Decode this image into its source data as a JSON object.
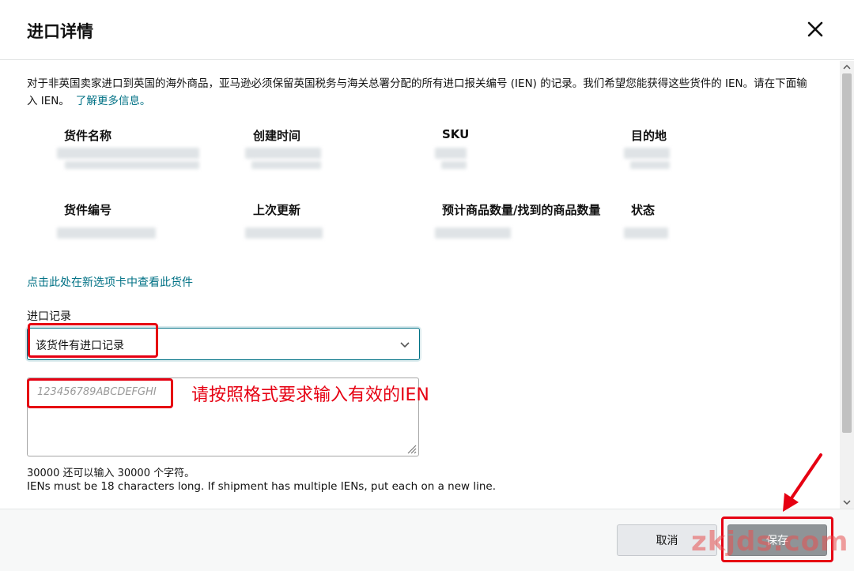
{
  "dialog": {
    "title": "进口详情",
    "close_icon": "close-icon"
  },
  "description": {
    "text": "对于非英国卖家进口到英国的海外商品，亚马逊必须保留英国税务与海关总署分配的所有进口报关编号 (IEN) 的记录。我们希望您能获得这些货件的 IEN。请在下面输入 IEN。",
    "link": "了解更多信息。"
  },
  "shipment_fields": [
    {
      "label": "货件名称"
    },
    {
      "label": "创建时间"
    },
    {
      "label": "SKU"
    },
    {
      "label": "目的地"
    },
    {
      "label": "货件编号"
    },
    {
      "label": "上次更新"
    },
    {
      "label": "预计商品数量/找到的商品数量"
    },
    {
      "label": "状态"
    }
  ],
  "view_link": "点击此处在新选项卡中查看此货件",
  "import_record": {
    "label": "进口记录",
    "selected": "该货件有进口记录"
  },
  "ien_input": {
    "placeholder": "123456789ABCDEFGHI",
    "value": ""
  },
  "char_count": "30000 还可以输入 30000 个字符。",
  "ien_rule": "IENs must be 18 characters long. If shipment has multiple IENs, put each on a new line.",
  "annotation": "请按照格式要求输入有效的IEN",
  "footer": {
    "cancel_label": "取消",
    "save_label": "保存"
  },
  "watermark": "zkjds.com",
  "colors": {
    "link": "#007185",
    "annotation": "#e60012",
    "save_button": "#8f9497"
  }
}
